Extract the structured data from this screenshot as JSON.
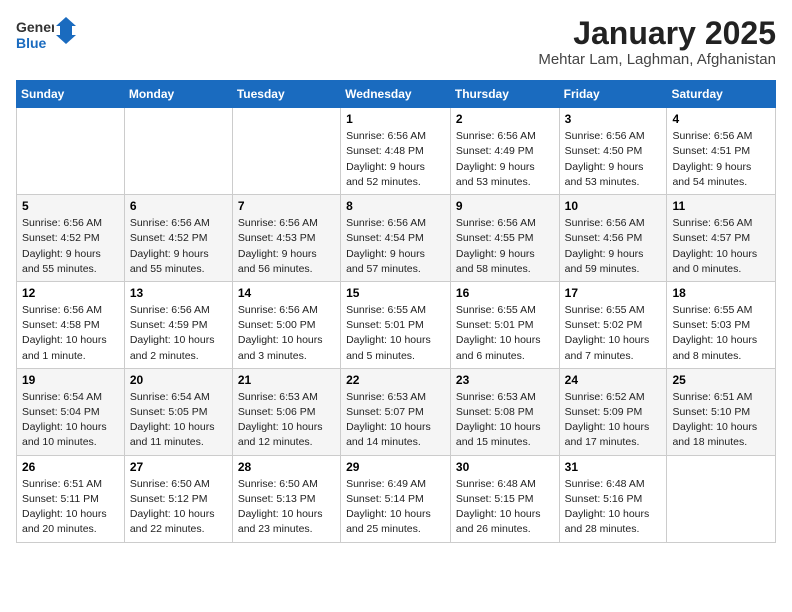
{
  "logo": {
    "line1": "General",
    "line2": "Blue"
  },
  "title": "January 2025",
  "subtitle": "Mehtar Lam, Laghman, Afghanistan",
  "days_of_week": [
    "Sunday",
    "Monday",
    "Tuesday",
    "Wednesday",
    "Thursday",
    "Friday",
    "Saturday"
  ],
  "weeks": [
    [
      {
        "day": "",
        "info": ""
      },
      {
        "day": "",
        "info": ""
      },
      {
        "day": "",
        "info": ""
      },
      {
        "day": "1",
        "info": "Sunrise: 6:56 AM\nSunset: 4:48 PM\nDaylight: 9 hours and 52 minutes."
      },
      {
        "day": "2",
        "info": "Sunrise: 6:56 AM\nSunset: 4:49 PM\nDaylight: 9 hours and 53 minutes."
      },
      {
        "day": "3",
        "info": "Sunrise: 6:56 AM\nSunset: 4:50 PM\nDaylight: 9 hours and 53 minutes."
      },
      {
        "day": "4",
        "info": "Sunrise: 6:56 AM\nSunset: 4:51 PM\nDaylight: 9 hours and 54 minutes."
      }
    ],
    [
      {
        "day": "5",
        "info": "Sunrise: 6:56 AM\nSunset: 4:52 PM\nDaylight: 9 hours and 55 minutes."
      },
      {
        "day": "6",
        "info": "Sunrise: 6:56 AM\nSunset: 4:52 PM\nDaylight: 9 hours and 55 minutes."
      },
      {
        "day": "7",
        "info": "Sunrise: 6:56 AM\nSunset: 4:53 PM\nDaylight: 9 hours and 56 minutes."
      },
      {
        "day": "8",
        "info": "Sunrise: 6:56 AM\nSunset: 4:54 PM\nDaylight: 9 hours and 57 minutes."
      },
      {
        "day": "9",
        "info": "Sunrise: 6:56 AM\nSunset: 4:55 PM\nDaylight: 9 hours and 58 minutes."
      },
      {
        "day": "10",
        "info": "Sunrise: 6:56 AM\nSunset: 4:56 PM\nDaylight: 9 hours and 59 minutes."
      },
      {
        "day": "11",
        "info": "Sunrise: 6:56 AM\nSunset: 4:57 PM\nDaylight: 10 hours and 0 minutes."
      }
    ],
    [
      {
        "day": "12",
        "info": "Sunrise: 6:56 AM\nSunset: 4:58 PM\nDaylight: 10 hours and 1 minute."
      },
      {
        "day": "13",
        "info": "Sunrise: 6:56 AM\nSunset: 4:59 PM\nDaylight: 10 hours and 2 minutes."
      },
      {
        "day": "14",
        "info": "Sunrise: 6:56 AM\nSunset: 5:00 PM\nDaylight: 10 hours and 3 minutes."
      },
      {
        "day": "15",
        "info": "Sunrise: 6:55 AM\nSunset: 5:01 PM\nDaylight: 10 hours and 5 minutes."
      },
      {
        "day": "16",
        "info": "Sunrise: 6:55 AM\nSunset: 5:01 PM\nDaylight: 10 hours and 6 minutes."
      },
      {
        "day": "17",
        "info": "Sunrise: 6:55 AM\nSunset: 5:02 PM\nDaylight: 10 hours and 7 minutes."
      },
      {
        "day": "18",
        "info": "Sunrise: 6:55 AM\nSunset: 5:03 PM\nDaylight: 10 hours and 8 minutes."
      }
    ],
    [
      {
        "day": "19",
        "info": "Sunrise: 6:54 AM\nSunset: 5:04 PM\nDaylight: 10 hours and 10 minutes."
      },
      {
        "day": "20",
        "info": "Sunrise: 6:54 AM\nSunset: 5:05 PM\nDaylight: 10 hours and 11 minutes."
      },
      {
        "day": "21",
        "info": "Sunrise: 6:53 AM\nSunset: 5:06 PM\nDaylight: 10 hours and 12 minutes."
      },
      {
        "day": "22",
        "info": "Sunrise: 6:53 AM\nSunset: 5:07 PM\nDaylight: 10 hours and 14 minutes."
      },
      {
        "day": "23",
        "info": "Sunrise: 6:53 AM\nSunset: 5:08 PM\nDaylight: 10 hours and 15 minutes."
      },
      {
        "day": "24",
        "info": "Sunrise: 6:52 AM\nSunset: 5:09 PM\nDaylight: 10 hours and 17 minutes."
      },
      {
        "day": "25",
        "info": "Sunrise: 6:51 AM\nSunset: 5:10 PM\nDaylight: 10 hours and 18 minutes."
      }
    ],
    [
      {
        "day": "26",
        "info": "Sunrise: 6:51 AM\nSunset: 5:11 PM\nDaylight: 10 hours and 20 minutes."
      },
      {
        "day": "27",
        "info": "Sunrise: 6:50 AM\nSunset: 5:12 PM\nDaylight: 10 hours and 22 minutes."
      },
      {
        "day": "28",
        "info": "Sunrise: 6:50 AM\nSunset: 5:13 PM\nDaylight: 10 hours and 23 minutes."
      },
      {
        "day": "29",
        "info": "Sunrise: 6:49 AM\nSunset: 5:14 PM\nDaylight: 10 hours and 25 minutes."
      },
      {
        "day": "30",
        "info": "Sunrise: 6:48 AM\nSunset: 5:15 PM\nDaylight: 10 hours and 26 minutes."
      },
      {
        "day": "31",
        "info": "Sunrise: 6:48 AM\nSunset: 5:16 PM\nDaylight: 10 hours and 28 minutes."
      },
      {
        "day": "",
        "info": ""
      }
    ]
  ]
}
